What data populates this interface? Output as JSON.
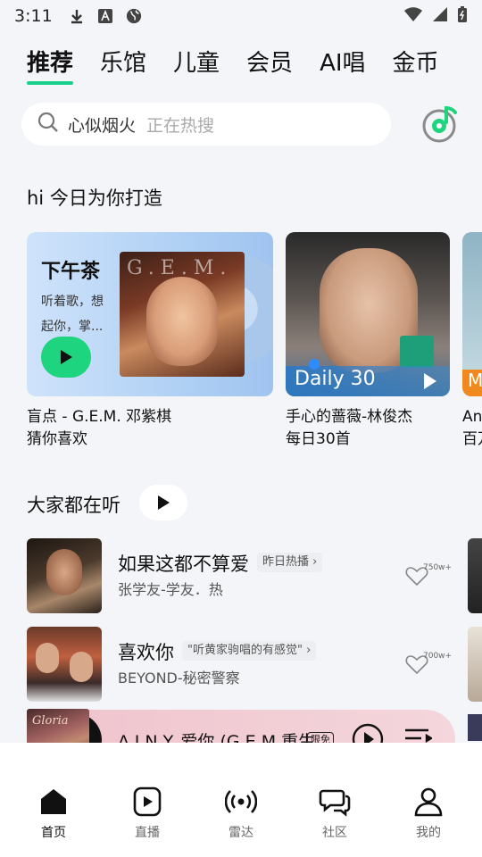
{
  "status_bar": {
    "time": "3:11"
  },
  "tabs": [
    {
      "label": "推荐",
      "active": true
    },
    {
      "label": "乐馆"
    },
    {
      "label": "儿童"
    },
    {
      "label": "会员"
    },
    {
      "label": "AI唱"
    },
    {
      "label": "金币"
    }
  ],
  "search": {
    "query": "心似烟火",
    "hint": "正在热搜"
  },
  "daily_section": {
    "title": "hi 今日为你打造",
    "cards": [
      {
        "title": "下午茶",
        "description": "听着歌，想起你，掌...",
        "cover_text": "G.E.M.",
        "caption1": "盲点 - G.E.M. 邓紫棋",
        "caption2": "猜你喜欢"
      },
      {
        "badge": "Daily 30",
        "caption1": "手心的蔷薇-林俊杰",
        "caption2": "每日30首"
      },
      {
        "tag": "M",
        "caption1": "An",
        "caption2": "百万"
      }
    ]
  },
  "popular_section": {
    "title": "大家都在听",
    "items": [
      {
        "title": "如果这都不算爱",
        "tag": "昨日热播",
        "subtitle": "张学友-学友．热",
        "likes": "750w+"
      },
      {
        "title": "喜欢你",
        "tag": "\"听黄家驹唱的有感觉\"",
        "subtitle": "BEYOND-秘密警察",
        "likes": "700w+"
      }
    ]
  },
  "player": {
    "song": "A.I.N.Y. 爱你 (G.E.M.重生",
    "limit_badge": "限免",
    "cover_text": "Gloria"
  },
  "bottom_nav": [
    {
      "label": "首页",
      "active": true
    },
    {
      "label": "直播"
    },
    {
      "label": "雷达"
    },
    {
      "label": "社区"
    },
    {
      "label": "我的"
    }
  ],
  "colors": {
    "accent": "#19d08a",
    "play_green": "#1ed47f",
    "background": "#f3f5f8"
  }
}
